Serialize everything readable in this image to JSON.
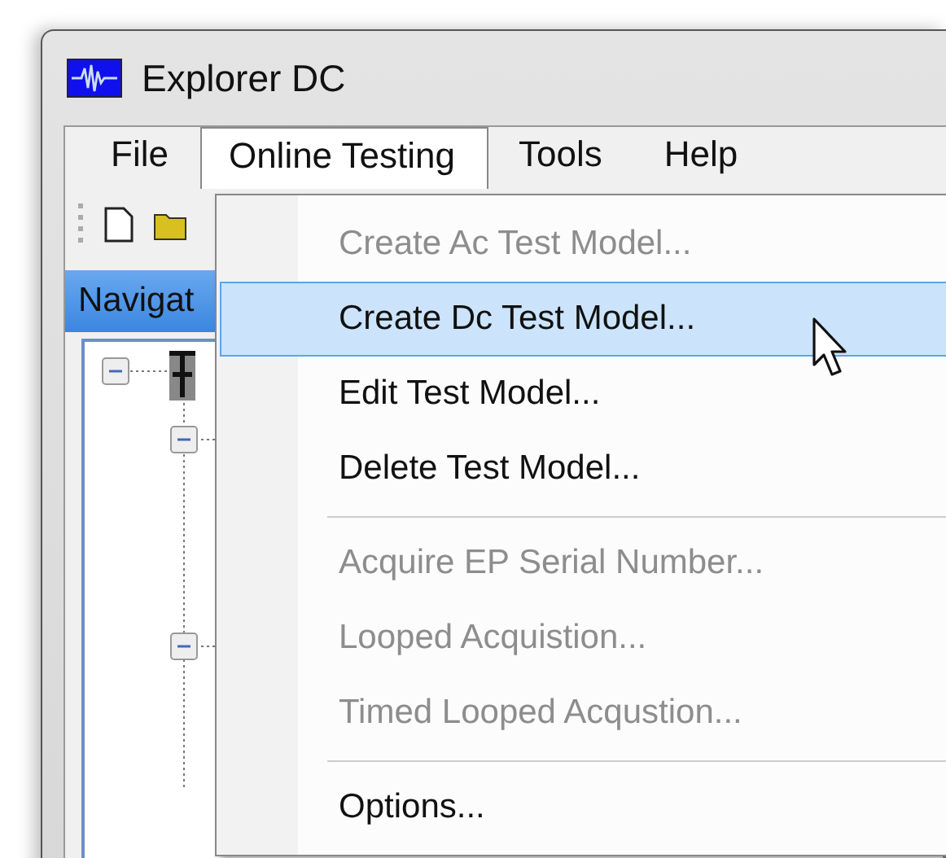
{
  "window": {
    "title": "Explorer DC"
  },
  "menu_bar": [
    {
      "label": "File",
      "selected": false
    },
    {
      "label": "Online Testing",
      "selected": true
    },
    {
      "label": "Tools",
      "selected": false
    },
    {
      "label": "Help",
      "selected": false
    }
  ],
  "navigator": {
    "title": "Navigat"
  },
  "dropdown": [
    {
      "kind": "item",
      "label": "Create Ac Test Model...",
      "disabled": true,
      "selected": false
    },
    {
      "kind": "item",
      "label": "Create Dc Test Model...",
      "disabled": false,
      "selected": true
    },
    {
      "kind": "item",
      "label": "Edit Test Model...",
      "disabled": false,
      "selected": false
    },
    {
      "kind": "item",
      "label": "Delete Test Model...",
      "disabled": false,
      "selected": false
    },
    {
      "kind": "separator"
    },
    {
      "kind": "item",
      "label": "Acquire EP Serial Number...",
      "disabled": true,
      "selected": false
    },
    {
      "kind": "item",
      "label": "Looped Acquistion...",
      "disabled": true,
      "selected": false
    },
    {
      "kind": "item",
      "label": "Timed Looped Acqustion...",
      "disabled": true,
      "selected": false
    },
    {
      "kind": "separator"
    },
    {
      "kind": "item",
      "label": "Options...",
      "disabled": false,
      "selected": false
    }
  ]
}
